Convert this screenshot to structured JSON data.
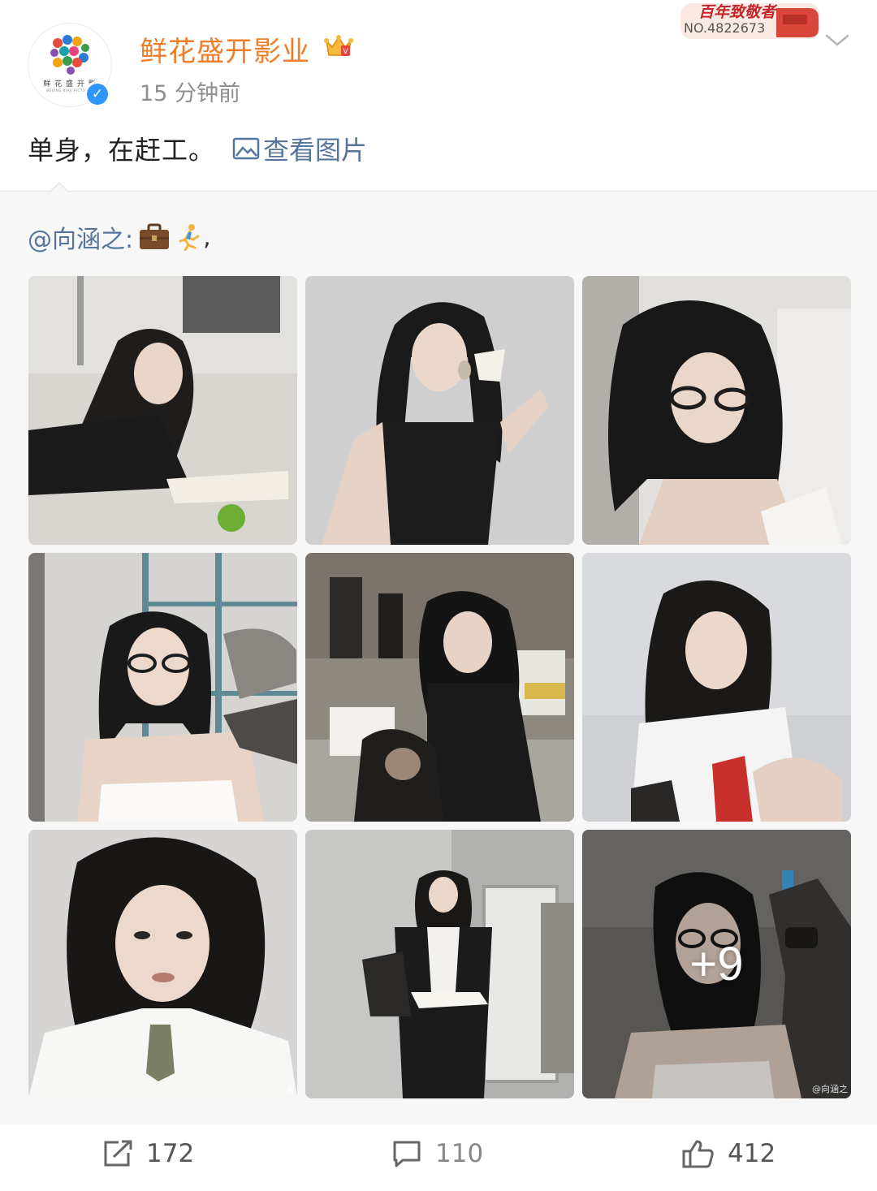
{
  "post": {
    "username": "鲜花盛开影业",
    "avatar_text": "鲜 花 盛 开 影",
    "avatar_subtext": "BEIJING XIAJI PICTURES",
    "timestamp": "15 分钟前",
    "medal_title": "百年致敬者",
    "medal_number": "NO.4822673",
    "text": "单身，在赶工。",
    "view_pictures_label": "查看图片"
  },
  "repost": {
    "mention": "@向涵之:",
    "trailing": ","
  },
  "photos": {
    "more_count": "+9",
    "watermark": "@向涵之",
    "items": [
      {
        "name": "photo-1",
        "bg": "#cfcbc6"
      },
      {
        "name": "photo-2",
        "bg": "#c9c9c9"
      },
      {
        "name": "photo-3",
        "bg": "#d4d2ce"
      },
      {
        "name": "photo-4",
        "bg": "#b9b6b0"
      },
      {
        "name": "photo-5",
        "bg": "#8f8a84"
      },
      {
        "name": "photo-6",
        "bg": "#c7c7c8"
      },
      {
        "name": "photo-7",
        "bg": "#d5d3d2"
      },
      {
        "name": "photo-8",
        "bg": "#b8b8b6"
      },
      {
        "name": "photo-9",
        "bg": "#6f6c69"
      }
    ]
  },
  "actions": {
    "repost_count": "172",
    "comment_count": "110",
    "like_count": "412"
  },
  "colors": {
    "username": "#f07d28",
    "link": "#55759c",
    "verified": "#2f95ff",
    "repost_bg": "#f7f7f7"
  }
}
